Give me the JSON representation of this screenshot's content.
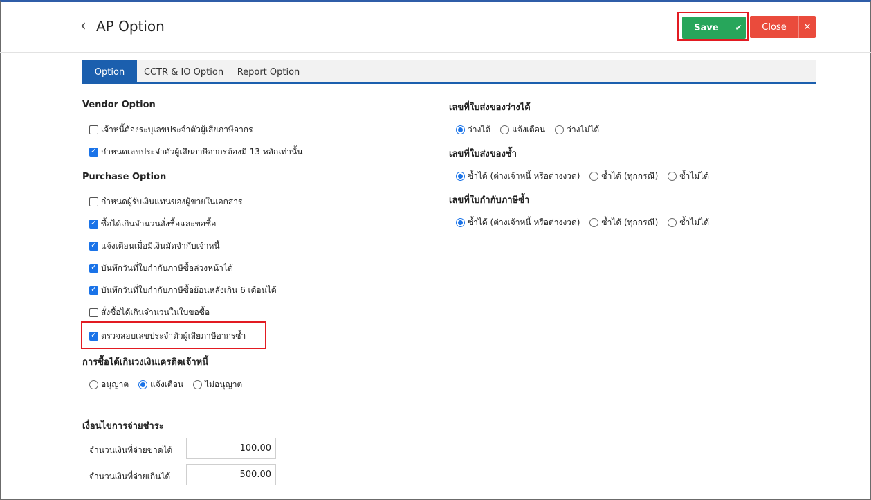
{
  "header": {
    "back_icon": "chevron-left-icon",
    "title": "AP Option",
    "save_label": "Save",
    "save_icon": "✔",
    "close_label": "Close",
    "close_icon": "✕"
  },
  "tabs": [
    {
      "label": "Option",
      "active": true
    },
    {
      "label": "CCTR & IO Option",
      "active": false
    },
    {
      "label": "Report Option",
      "active": false
    }
  ],
  "vendor": {
    "title": "Vendor Option",
    "items": [
      {
        "label": "เจ้าหนี้ต้องระบุเลขประจำตัวผู้เสียภาษีอากร",
        "checked": false
      },
      {
        "label": "กำหนดเลขประจำตัวผู้เสียภาษีอากรต้องมี 13 หลักเท่านั้น",
        "checked": true
      }
    ]
  },
  "purchase": {
    "title": "Purchase Option",
    "items": [
      {
        "label": "กำหนดผู้รับเงินแทนของผู้ขายในเอกสาร",
        "checked": false
      },
      {
        "label": "ซื้อได้เกินจำนวนสั่งซื้อและขอซื้อ",
        "checked": true
      },
      {
        "label": "แจ้งเตือนเมื่อมีเงินมัดจำกับเจ้าหนี้",
        "checked": true
      },
      {
        "label": "บันทึกวันที่ใบกำกับภาษีซื้อล่วงหน้าได้",
        "checked": true
      },
      {
        "label": "บันทึกวันที่ใบกำกับภาษีซื้อย้อนหลังเกิน 6 เดือนได้",
        "checked": true
      },
      {
        "label": "สั่งซื้อได้เกินจำนวนในใบขอซื้อ",
        "checked": false
      },
      {
        "label": "ตรวจสอบเลขประจำตัวผู้เสียภาษีอากรซ้ำ",
        "checked": true
      }
    ]
  },
  "credit": {
    "title": "การซื้อได้เกินวงเงินเครดิตเจ้าหนี้",
    "options": [
      {
        "label": "อนุญาต",
        "selected": false
      },
      {
        "label": "แจ้งเตือน",
        "selected": true
      },
      {
        "label": "ไม่อนุญาต",
        "selected": false
      }
    ]
  },
  "delivery_blank": {
    "title": "เลขที่ใบส่งของว่างได้",
    "options": [
      {
        "label": "ว่างได้",
        "selected": true
      },
      {
        "label": "แจ้งเตือน",
        "selected": false
      },
      {
        "label": "ว่างไม่ได้",
        "selected": false
      }
    ]
  },
  "delivery_dup": {
    "title": "เลขที่ใบส่งของซ้ำ",
    "options": [
      {
        "label": "ซ้ำได้ (ต่างเจ้าหนี้ หรือต่างงวด)",
        "selected": true
      },
      {
        "label": "ซ้ำได้ (ทุกกรณี)",
        "selected": false
      },
      {
        "label": "ซ้ำไม่ได้",
        "selected": false
      }
    ]
  },
  "tax_dup": {
    "title": "เลขที่ใบกำกับภาษีซ้ำ",
    "options": [
      {
        "label": "ซ้ำได้ (ต่างเจ้าหนี้ หรือต่างงวด)",
        "selected": true
      },
      {
        "label": "ซ้ำได้ (ทุกกรณี)",
        "selected": false
      },
      {
        "label": "ซ้ำไม่ได้",
        "selected": false
      }
    ]
  },
  "payment": {
    "title": "เงื่อนไขการจ่ายชำระ",
    "under_label": "จำนวนเงินที่จ่ายขาดได้",
    "under_value": "100.00",
    "over_label": "จำนวนเงินที่จ่ายเกินได้",
    "over_value": "500.00"
  },
  "colors": {
    "save": "#27a65b",
    "close": "#ea4b3c",
    "tab_active": "#1b5fae",
    "check": "#1a73e8",
    "highlight": "#e21b22"
  }
}
